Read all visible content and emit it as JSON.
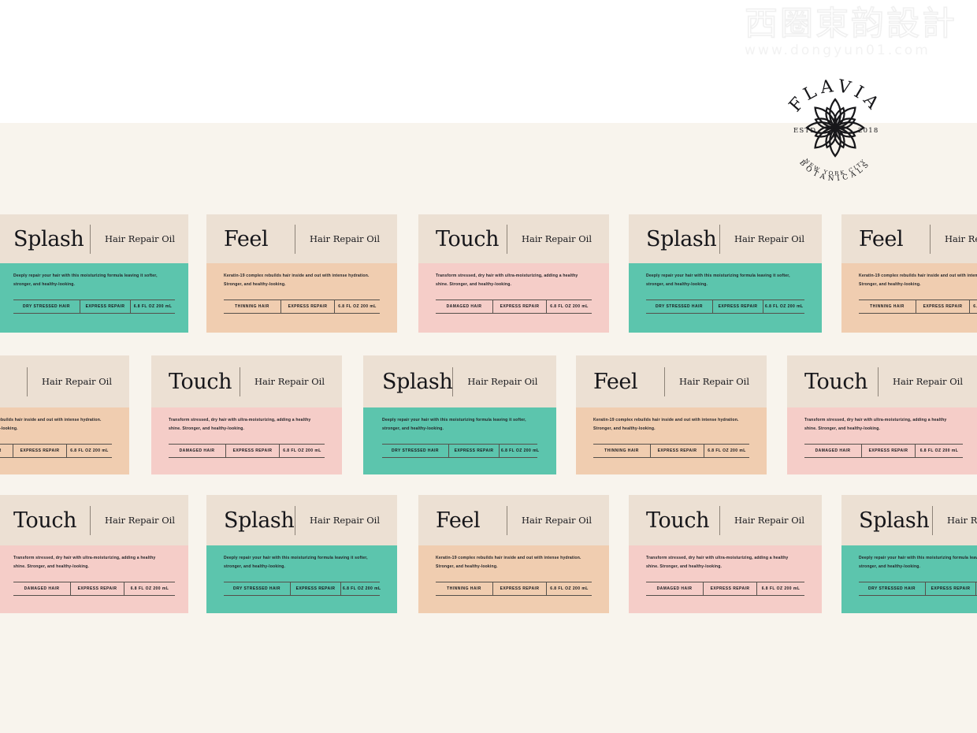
{
  "brand": {
    "name": "FLAVIA",
    "estd_label": "ESTD",
    "estd_year": "2018",
    "line2": "BOTANICALS",
    "line3": "NEW YORK CITY",
    "mark": "lotus-flower-mark"
  },
  "watermark": {
    "cjk": "西圈東韵設計",
    "url": "www.dongyun01.com"
  },
  "common": {
    "subtitle": "Hair Repair Oil",
    "middle_spec": "EXPRESS REPAIR",
    "volume": "6.8 FL OZ 200 mL"
  },
  "products": {
    "splash": {
      "name": "Splash",
      "subtitle": "Hair Repair Oil",
      "description": "Deeply repair your hair with this moisturizing formula leaving it softer, stronger, and healthy-looking.",
      "hair_type": "DRY STRESSED HAIR",
      "benefit": "EXPRESS REPAIR",
      "volume": "6.8 FL OZ 200 mL",
      "accent": "#5cc5ad"
    },
    "feel": {
      "name": "Feel",
      "subtitle": "Hair Repair Oil",
      "description": "Keratin-19 complex rebuilds hair inside and out with intense hydration. Stronger, and healthy-looking.",
      "hair_type": "THINNING HAIR",
      "benefit": "EXPRESS REPAIR",
      "volume": "6.8 FL OZ 200 mL",
      "accent": "#f0cdb0"
    },
    "touch": {
      "name": "Touch",
      "subtitle": "Hair Repair Oil",
      "description": "Transform stressed, dry hair with ultra-moisturizing, adding a healthy shine. Stronger, and healthy-looking.",
      "hair_type": "DAMAGED HAIR",
      "benefit": "EXPRESS REPAIR",
      "volume": "6.8 FL OZ 200 mL",
      "accent": "#f5cdc8"
    }
  },
  "palette": {
    "page_background": "#f8f4ed",
    "card_header": "#ece0d3",
    "mint": "#5cc5ad",
    "peach": "#f0cdb0",
    "pink": "#f5cdc8",
    "ink": "#17171a"
  }
}
